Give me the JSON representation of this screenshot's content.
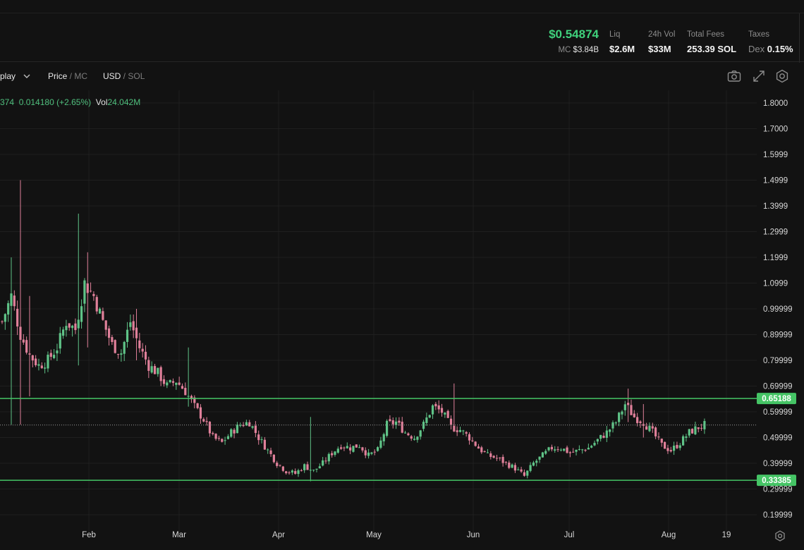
{
  "header": {
    "price": "$0.54874",
    "mc_label": "MC",
    "mc_value": "$3.84B",
    "stats": [
      {
        "label": "Liq",
        "value": "$2.6M"
      },
      {
        "label": "24h Vol",
        "value": "$33M"
      },
      {
        "label": "Total Fees",
        "value": "253.39 SOL"
      },
      {
        "label": "Taxes",
        "prefix": "Dex",
        "value": "0.15%"
      }
    ]
  },
  "toolbar": {
    "display_label": "play",
    "price_label": "Price",
    "price_alt": "MC",
    "currency_label": "USD",
    "currency_alt": "SOL",
    "icons": [
      "camera-icon",
      "expand-icon",
      "settings-icon"
    ]
  },
  "legend": {
    "last_fragment": "374",
    "change": "0.014180 (+2.65%)",
    "vol_label": "Vol",
    "vol_value": "24.042M"
  },
  "chart_data": {
    "type": "candlestick",
    "x_tick_labels": [
      "Feb",
      "Mar",
      "Apr",
      "May",
      "Jun",
      "Jul",
      "Aug",
      "19"
    ],
    "y_tick_labels": [
      "1.8000",
      "1.7000",
      "1.5999",
      "1.4999",
      "1.3999",
      "1.2999",
      "1.1999",
      "1.0999",
      "0.99999",
      "0.89999",
      "0.79999",
      "0.69999",
      "0.59999",
      "0.49999",
      "0.39999",
      "0.29999",
      "0.19999"
    ],
    "y_range": [
      0.16,
      1.84
    ],
    "horizontal_lines": [
      {
        "value": 0.65188,
        "label": "0.65188",
        "color": "#45c465"
      },
      {
        "value": 0.33385,
        "label": "0.33385",
        "color": "#45c465"
      }
    ],
    "last_price": 0.54874,
    "close_path": [
      [
        0,
        0.95
      ],
      [
        3,
        1.05
      ],
      [
        6,
        0.9
      ],
      [
        9,
        0.82
      ],
      [
        12,
        0.78
      ],
      [
        15,
        0.8
      ],
      [
        18,
        0.85
      ],
      [
        21,
        0.95
      ],
      [
        24,
        0.92
      ],
      [
        27,
        1.1
      ],
      [
        30,
        1.05
      ],
      [
        33,
        0.95
      ],
      [
        36,
        0.86
      ],
      [
        39,
        0.83
      ],
      [
        42,
        0.95
      ],
      [
        45,
        0.85
      ],
      [
        48,
        0.78
      ],
      [
        51,
        0.75
      ],
      [
        54,
        0.7
      ],
      [
        57,
        0.72
      ],
      [
        60,
        0.68
      ],
      [
        63,
        0.62
      ],
      [
        66,
        0.57
      ],
      [
        69,
        0.5
      ],
      [
        72,
        0.48
      ],
      [
        75,
        0.52
      ],
      [
        78,
        0.55
      ],
      [
        81,
        0.56
      ],
      [
        84,
        0.5
      ],
      [
        87,
        0.45
      ],
      [
        90,
        0.4
      ],
      [
        93,
        0.37
      ],
      [
        96,
        0.36
      ],
      [
        99,
        0.39
      ],
      [
        102,
        0.37
      ],
      [
        105,
        0.4
      ],
      [
        108,
        0.44
      ],
      [
        111,
        0.47
      ],
      [
        114,
        0.46
      ],
      [
        117,
        0.47
      ],
      [
        120,
        0.43
      ],
      [
        123,
        0.45
      ],
      [
        126,
        0.55
      ],
      [
        129,
        0.56
      ],
      [
        132,
        0.52
      ],
      [
        135,
        0.5
      ],
      [
        138,
        0.55
      ],
      [
        141,
        0.62
      ],
      [
        144,
        0.6
      ],
      [
        147,
        0.54
      ],
      [
        150,
        0.53
      ],
      [
        153,
        0.5
      ],
      [
        156,
        0.46
      ],
      [
        159,
        0.43
      ],
      [
        162,
        0.42
      ],
      [
        165,
        0.4
      ],
      [
        168,
        0.38
      ],
      [
        171,
        0.35
      ],
      [
        174,
        0.4
      ],
      [
        177,
        0.43
      ],
      [
        180,
        0.46
      ],
      [
        183,
        0.46
      ],
      [
        186,
        0.44
      ],
      [
        189,
        0.45
      ],
      [
        192,
        0.46
      ],
      [
        195,
        0.49
      ],
      [
        198,
        0.52
      ],
      [
        201,
        0.56
      ],
      [
        204,
        0.63
      ],
      [
        207,
        0.58
      ],
      [
        210,
        0.56
      ],
      [
        213,
        0.52
      ],
      [
        216,
        0.47
      ],
      [
        219,
        0.45
      ],
      [
        222,
        0.48
      ],
      [
        225,
        0.52
      ],
      [
        228,
        0.54
      ],
      [
        230,
        0.549
      ]
    ],
    "spikes": [
      {
        "day": 3,
        "high": 1.2,
        "low": 0.55
      },
      {
        "day": 6,
        "high": 1.5,
        "low": 0.55
      },
      {
        "day": 9,
        "high": 1.05,
        "low": 0.66
      },
      {
        "day": 25,
        "high": 1.37,
        "low": 0.78
      },
      {
        "day": 28,
        "high": 1.22,
        "low": 0.85
      },
      {
        "day": 44,
        "high": 1.0,
        "low": 0.8
      },
      {
        "day": 61,
        "high": 0.85,
        "low": 0.62
      },
      {
        "day": 101,
        "high": 0.58,
        "low": 0.33
      },
      {
        "day": 148,
        "high": 0.71,
        "low": 0.56
      },
      {
        "day": 205,
        "high": 0.69,
        "low": 0.56
      },
      {
        "day": 210,
        "high": 0.63,
        "low": 0.5
      }
    ],
    "colors": {
      "up": "#5fc387",
      "down": "#e0809a",
      "background": "#121212",
      "grid": "#1f1f1f"
    }
  }
}
